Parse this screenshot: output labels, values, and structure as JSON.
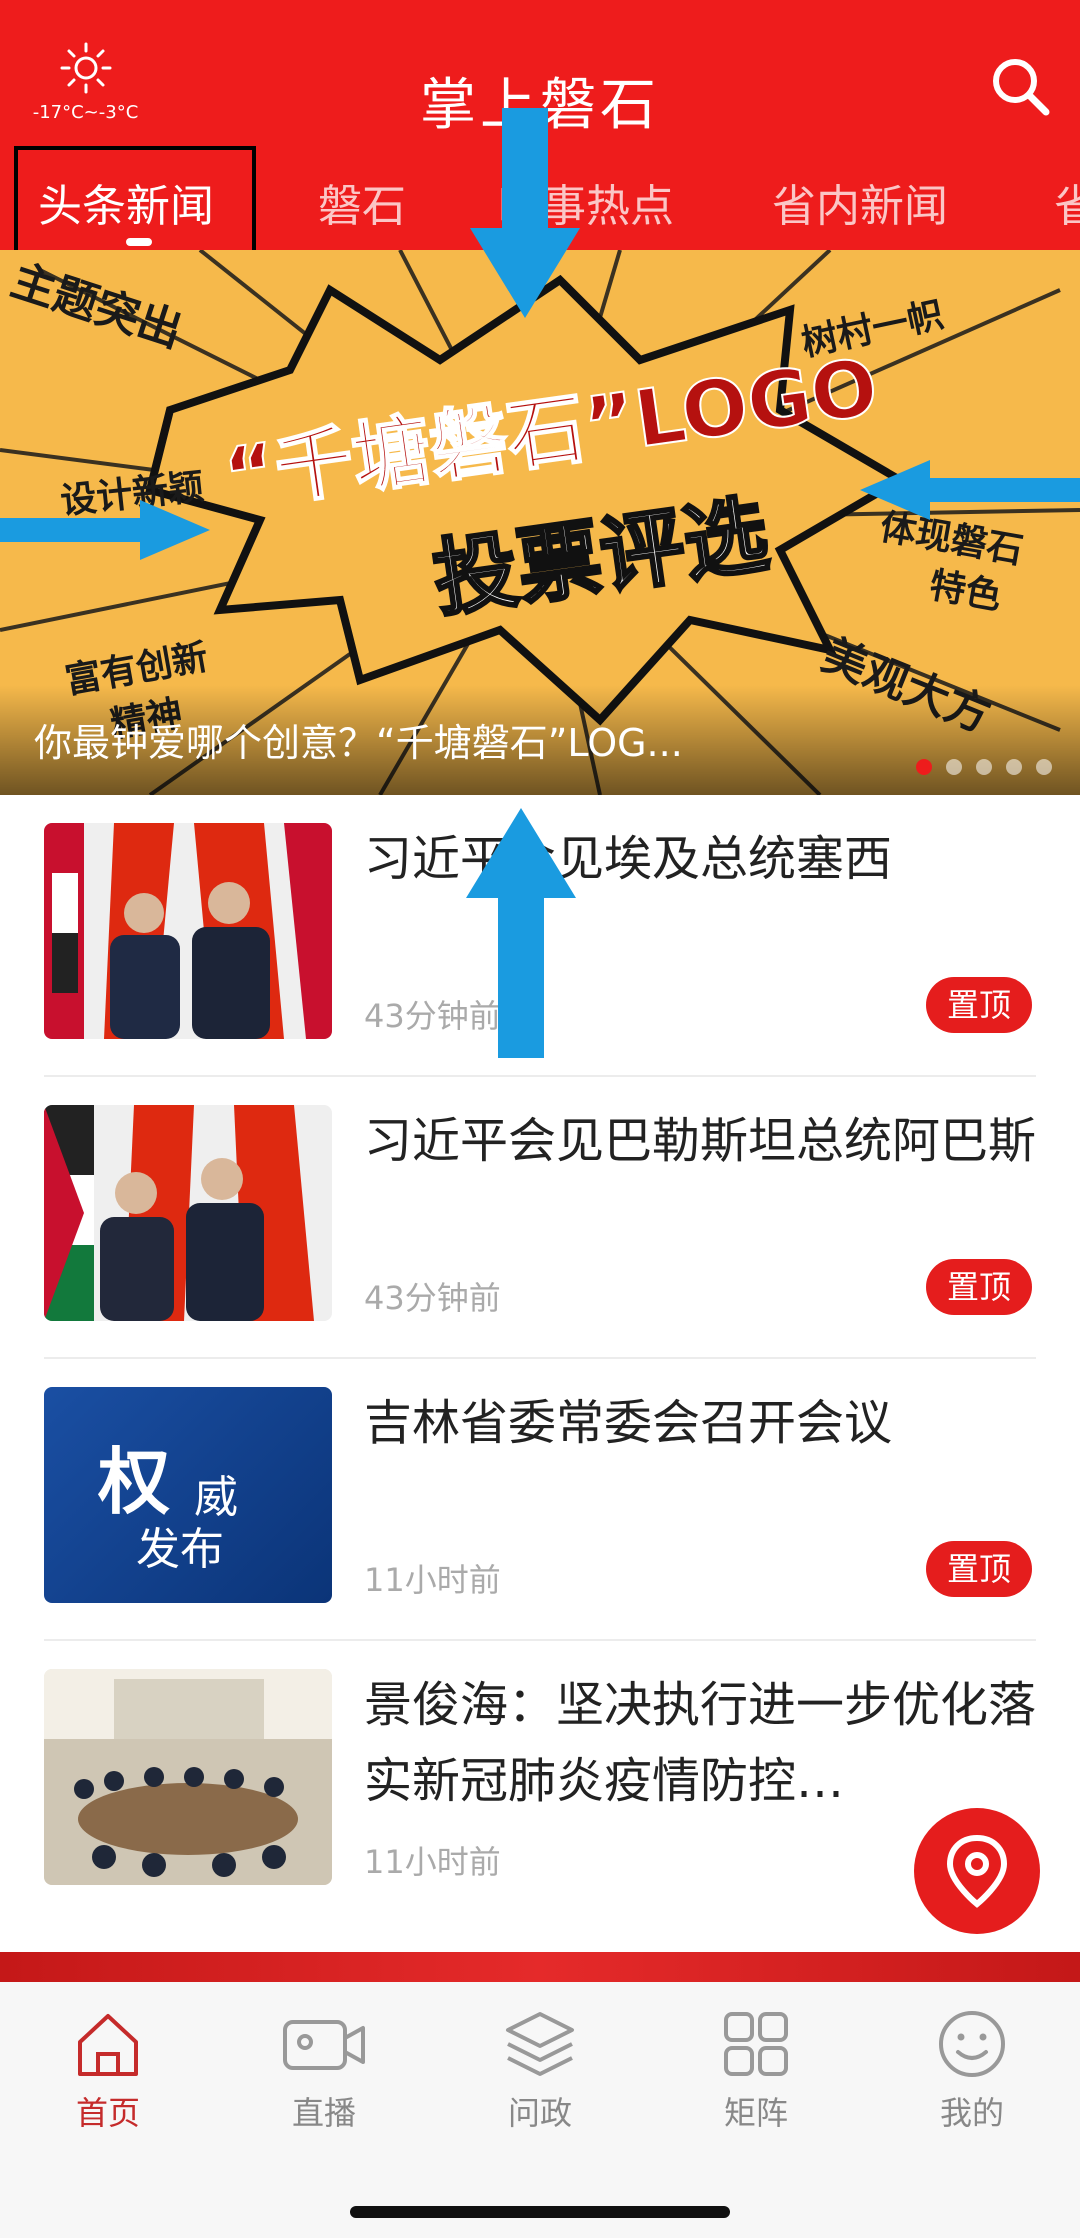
{
  "header": {
    "weather_temp": "-17°C~-3°C",
    "app_title": "掌上磐石",
    "tabs": [
      "头条新闻",
      "磐石",
      "时事热点",
      "省内新闻",
      "省"
    ]
  },
  "banner": {
    "stickers": [
      "主题突出",
      "设计新颖",
      "富有创新",
      "精神",
      "树村一帜",
      "体现磐石",
      "特色",
      "美观大方"
    ],
    "big_title": "“千塘磐石”LOGO",
    "sub_title": "投票评选",
    "caption": "你最钟爱哪个创意？“千塘磐石”LOG...",
    "slide_count": 5,
    "active_slide": 1
  },
  "news": [
    {
      "title": "习近平会见埃及总统塞西",
      "time": "43分钟前",
      "badge": "置顶"
    },
    {
      "title": "习近平会见巴勒斯坦总统阿巴斯",
      "time": "43分钟前",
      "badge": "置顶"
    },
    {
      "title": "吉林省委常委会召开会议",
      "time": "11小时前",
      "badge": "置顶",
      "thumb_text_a": "权",
      "thumb_text_b": "威",
      "thumb_text_c": "发布"
    },
    {
      "title": "景俊海：坚决执行进一步优化落实新冠肺炎疫情防控…",
      "time": "11小时前"
    }
  ],
  "bottom_nav": {
    "items": [
      "首页",
      "直播",
      "问政",
      "矩阵",
      "我的"
    ],
    "active": "首页"
  },
  "colors": {
    "brand_red": "#ee1c1c",
    "badge_red": "#e51d1d",
    "nav_active": "#c52b2b",
    "banner_yellow": "#f6b94b",
    "annotation_blue": "#1a9be0"
  }
}
